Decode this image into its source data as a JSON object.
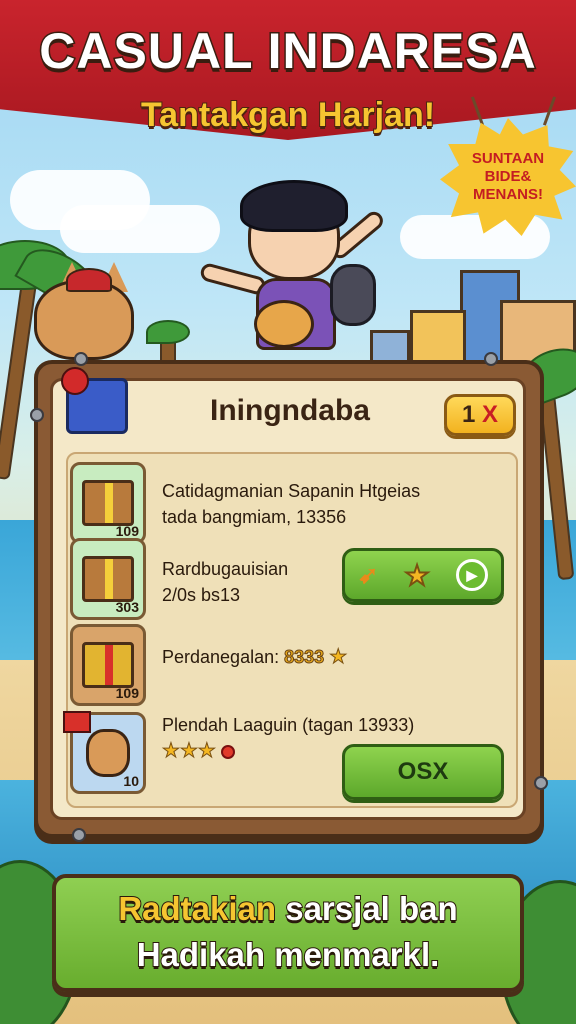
{
  "header": {
    "title": "CASUAL INDARESA",
    "subtitle": "Tantakgan Harjan!"
  },
  "promo_sign": {
    "lines": [
      "SUNTAAN",
      "BIDE&",
      "MENANS!"
    ]
  },
  "panel": {
    "title": "Iningndaba",
    "close_label": "1",
    "close_x": "X",
    "items": [
      {
        "icon": "gold-box-icon",
        "count": "109",
        "line1": "Catidagmanian Sapanin Htgeias",
        "line2": "tada bangmiam, 13356"
      },
      {
        "icon": "wooden-box-icon",
        "count": "303",
        "line1": "Rardbugauisian",
        "line2": "2/0s bs13",
        "button_icons": [
          "rocket-icon",
          "star-icon",
          "play-icon"
        ]
      },
      {
        "icon": "gift-box-icon",
        "count": "109",
        "label": "Perdanegalan:",
        "value": "8333"
      },
      {
        "icon": "fox-avatar-icon",
        "count": "10",
        "line1": "Plendah Laaguin (tagan 13933)",
        "stars": 3,
        "button_label": "OSX"
      }
    ]
  },
  "footer": {
    "line1_highlight": "Radtakian",
    "line1_rest": " sarsjal ban",
    "line2": "Hadikah menmarkl."
  },
  "colors": {
    "banner_red": "#c9242d",
    "accent_yellow": "#f6c531",
    "button_green": "#6cbc30",
    "panel_wood": "#8a5a34",
    "panel_paper": "#f4e8c8"
  }
}
